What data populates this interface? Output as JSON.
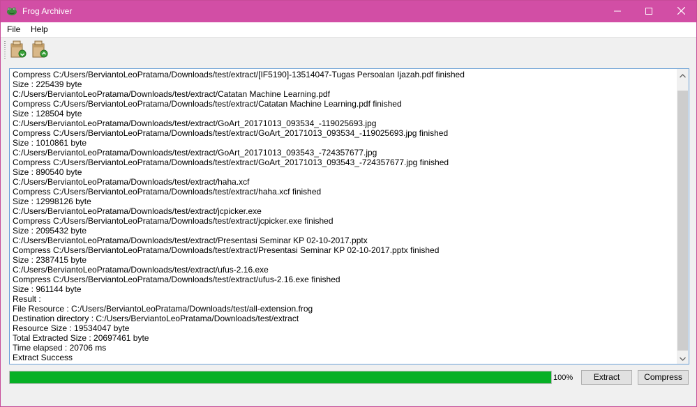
{
  "window": {
    "title": "Frog Archiver",
    "icon": "frog-icon"
  },
  "titlebar_controls": {
    "minimize_icon": "minimize-icon",
    "maximize_icon": "maximize-icon",
    "close_icon": "close-icon"
  },
  "menu": {
    "items": [
      {
        "label": "File"
      },
      {
        "label": "Help"
      }
    ]
  },
  "toolbar": {
    "extract_icon": "extract-archive-icon",
    "compress_icon": "compress-archive-icon"
  },
  "log": {
    "lines": [
      "Compress C:/Users/BerviantoLeoPratama/Downloads/test/extract/[IF5190]-13514047-Tugas Persoalan Ijazah.pdf finished",
      "Size : 225439 byte",
      "C:/Users/BerviantoLeoPratama/Downloads/test/extract/Catatan Machine Learning.pdf",
      "Compress C:/Users/BerviantoLeoPratama/Downloads/test/extract/Catatan Machine Learning.pdf finished",
      "Size : 128504 byte",
      "C:/Users/BerviantoLeoPratama/Downloads/test/extract/GoArt_20171013_093534_-119025693.jpg",
      "Compress C:/Users/BerviantoLeoPratama/Downloads/test/extract/GoArt_20171013_093534_-119025693.jpg finished",
      "Size : 1010861 byte",
      "C:/Users/BerviantoLeoPratama/Downloads/test/extract/GoArt_20171013_093543_-724357677.jpg",
      "Compress C:/Users/BerviantoLeoPratama/Downloads/test/extract/GoArt_20171013_093543_-724357677.jpg finished",
      "Size : 890540 byte",
      "C:/Users/BerviantoLeoPratama/Downloads/test/extract/haha.xcf",
      "Compress C:/Users/BerviantoLeoPratama/Downloads/test/extract/haha.xcf finished",
      "Size : 12998126 byte",
      "C:/Users/BerviantoLeoPratama/Downloads/test/extract/jcpicker.exe",
      "Compress C:/Users/BerviantoLeoPratama/Downloads/test/extract/jcpicker.exe finished",
      "Size : 2095432 byte",
      "C:/Users/BerviantoLeoPratama/Downloads/test/extract/Presentasi Seminar KP 02-10-2017.pptx",
      "Compress C:/Users/BerviantoLeoPratama/Downloads/test/extract/Presentasi Seminar KP 02-10-2017.pptx finished",
      "Size : 2387415 byte",
      "C:/Users/BerviantoLeoPratama/Downloads/test/extract/ufus-2.16.exe",
      "Compress C:/Users/BerviantoLeoPratama/Downloads/test/extract/ufus-2.16.exe finished",
      "Size : 961144 byte",
      "Result :",
      "File Resource : C:/Users/BerviantoLeoPratama/Downloads/test/all-extension.frog",
      "Destination directory : C:/Users/BerviantoLeoPratama/Downloads/test/extract",
      "Resource Size : 19534047 byte",
      "Total Extracted Size : 20697461 byte",
      "Time elapsed : 20706 ms",
      "Extract Success"
    ]
  },
  "progress": {
    "value": 1.0,
    "label": "100%"
  },
  "buttons": {
    "extract_label": "Extract",
    "compress_label": "Compress"
  },
  "colors": {
    "titlebar": "#d24ea5",
    "progress_fill": "#06b025"
  }
}
